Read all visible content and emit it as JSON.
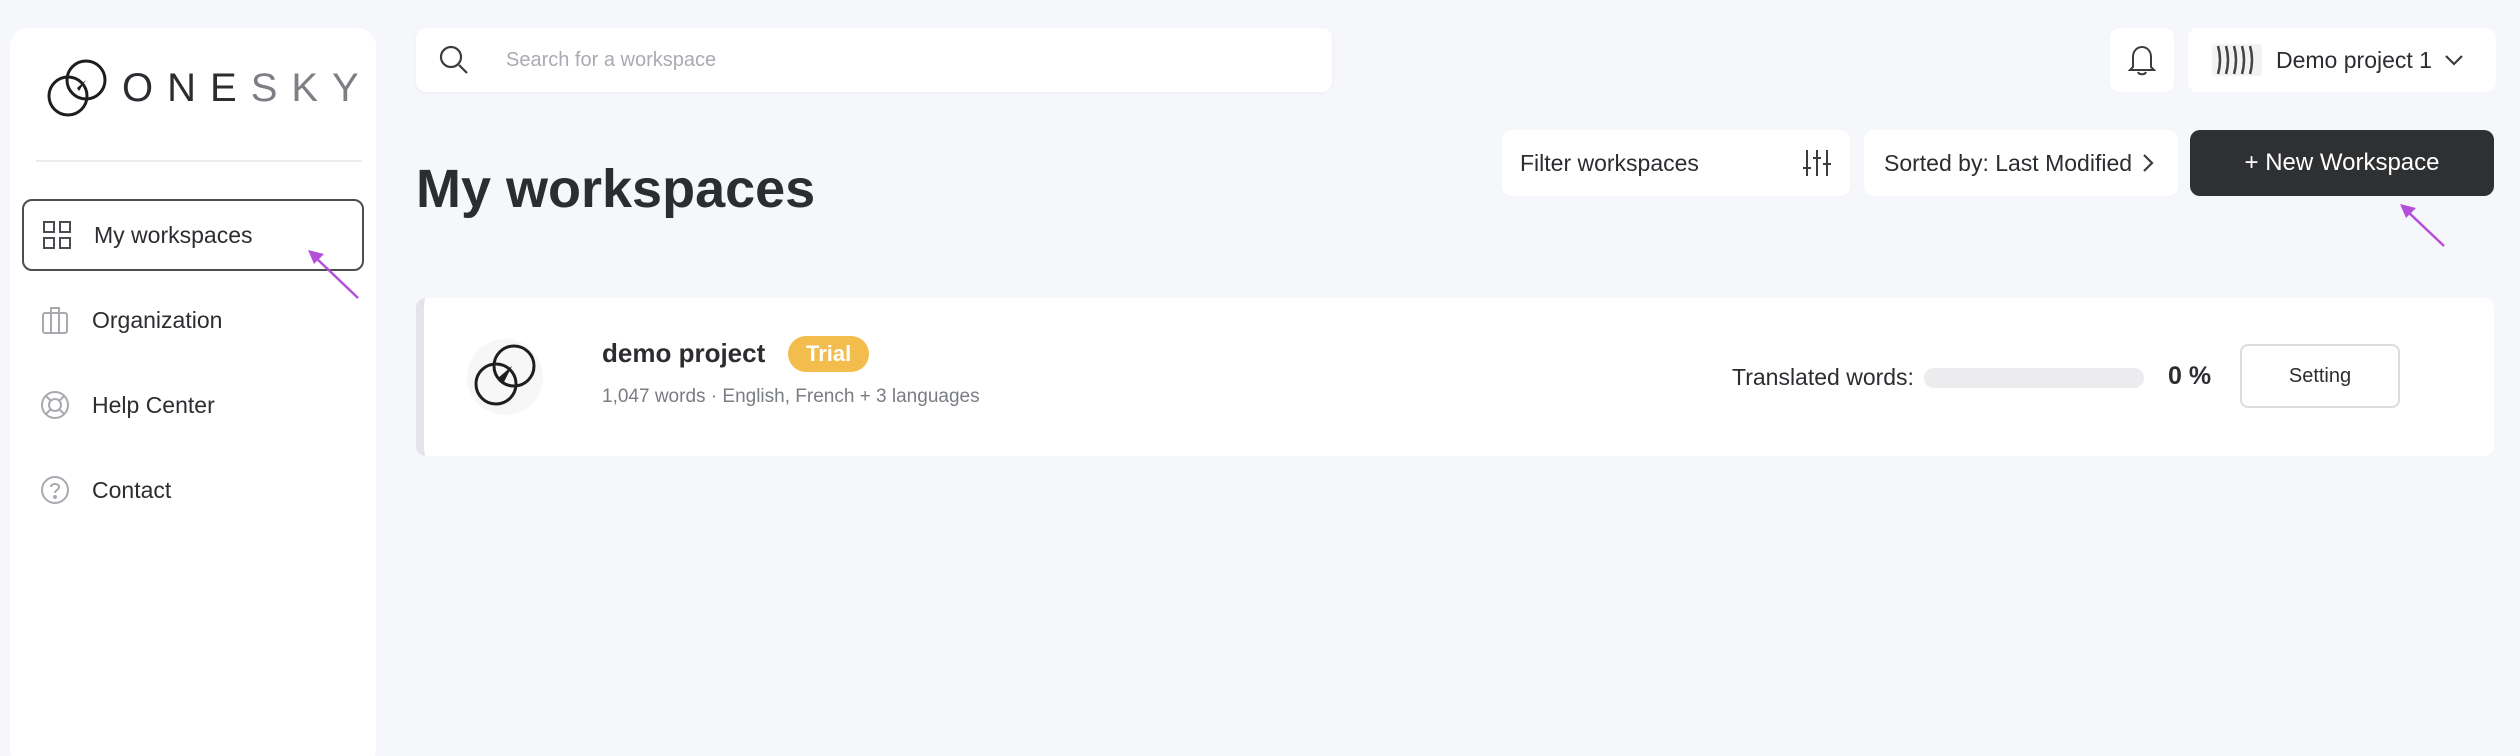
{
  "sidebar": {
    "logo": {
      "text_main": "ONE",
      "text_dim": "SKY"
    },
    "items": [
      {
        "label": "My workspaces",
        "icon": "grid-icon",
        "active": true
      },
      {
        "label": "Organization",
        "icon": "building-icon",
        "active": false
      },
      {
        "label": "Help Center",
        "icon": "lifebuoy-icon",
        "active": false
      },
      {
        "label": "Contact",
        "icon": "question-circle-icon",
        "active": false
      }
    ]
  },
  "header": {
    "search_placeholder": "Search for a workspace",
    "project_name": "Demo project 1"
  },
  "page": {
    "title": "My workspaces",
    "filter_label": "Filter workspaces",
    "sort_label": "Sorted by: Last Modified",
    "new_workspace_label": "+ New Workspace"
  },
  "workspaces": [
    {
      "name": "demo project",
      "badge": "Trial",
      "meta": "1,047 words · English, French + 3 languages",
      "translated_label": "Translated words:",
      "translated_fraction": 0,
      "translated_pct": "0 %",
      "setting_label": "Setting"
    }
  ],
  "colors": {
    "accent_dark": "#2f3032",
    "badge": "#f2bd4c",
    "annotation_arrow": "#b44fd9",
    "background": "#f6f7fb"
  }
}
